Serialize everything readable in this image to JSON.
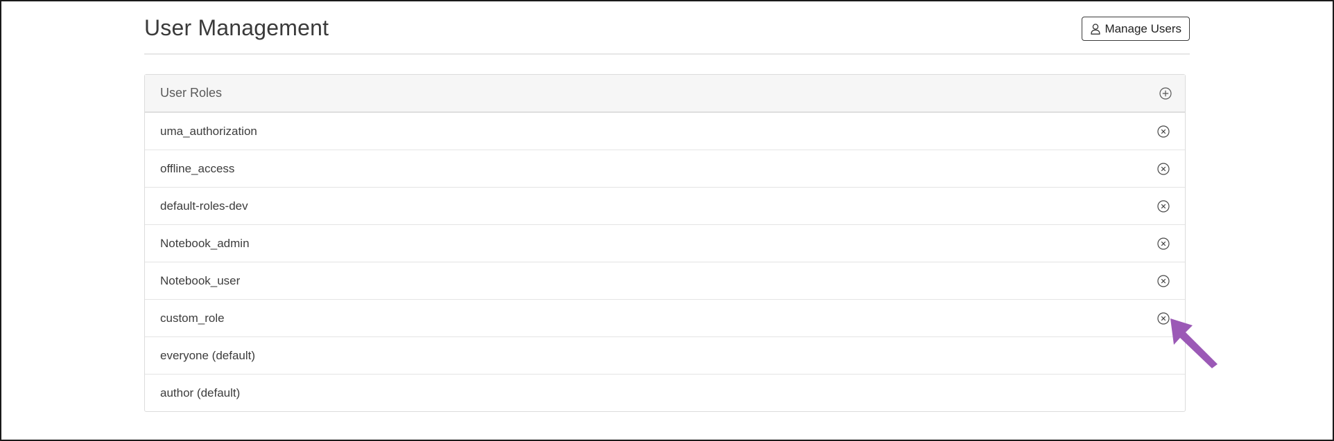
{
  "header": {
    "title": "User Management",
    "manage_users_label": "Manage Users"
  },
  "panel": {
    "title": "User Roles",
    "roles": [
      {
        "label": "uma_authorization",
        "removable": true
      },
      {
        "label": "offline_access",
        "removable": true
      },
      {
        "label": "default-roles-dev",
        "removable": true
      },
      {
        "label": "Notebook_admin",
        "removable": true
      },
      {
        "label": "Notebook_user",
        "removable": true
      },
      {
        "label": "custom_role",
        "removable": true
      },
      {
        "label": "everyone (default)",
        "removable": false
      },
      {
        "label": "author (default)",
        "removable": false
      }
    ]
  },
  "icons": {
    "manage_users": "user-icon",
    "add_role": "plus-circle-icon",
    "remove_role": "x-circle-icon",
    "pointer": "arrow-pointer"
  },
  "colors": {
    "arrow": "#9b59b6"
  }
}
